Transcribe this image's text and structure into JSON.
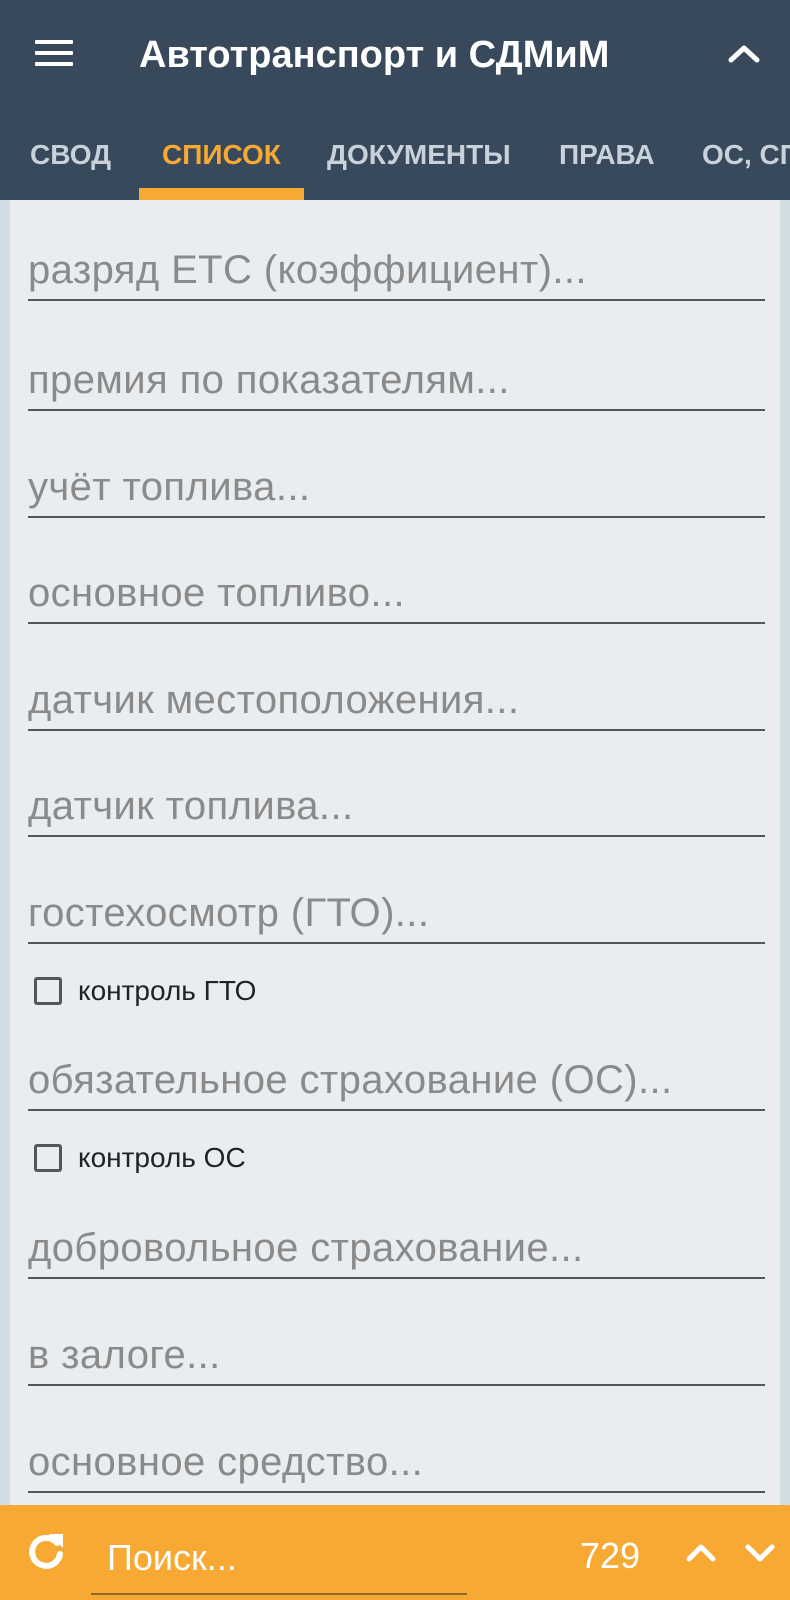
{
  "header": {
    "title": "Автотранспорт и СДМиМ",
    "icons": {
      "menu": "hamburger-menu-icon",
      "collapse": "chevron-up-icon"
    }
  },
  "tabs": [
    {
      "label": "СВОД",
      "active": false
    },
    {
      "label": "СПИСОК",
      "active": true
    },
    {
      "label": "ДОКУМЕНТЫ",
      "active": false
    },
    {
      "label": "ПРАВА",
      "active": false
    },
    {
      "label": "ОС, СП",
      "active": false
    }
  ],
  "form": {
    "fields": [
      "разряд ЕТС (коэффициент)...",
      "премия по показателям...",
      "учёт топлива...",
      "основное топливо...",
      "датчик местоположения...",
      "датчик топлива...",
      "гостехосмотр (ГТО)...",
      "обязательное страхование (ОС)...",
      "добровольное страхование...",
      "в залоге...",
      "основное средство..."
    ],
    "checkboxes": [
      {
        "label": "контроль ГТО",
        "checked": false
      },
      {
        "label": "контроль ОС",
        "checked": false
      }
    ]
  },
  "bottom_bar": {
    "search_placeholder": "Поиск...",
    "count": "729",
    "icons": {
      "refresh": "refresh-icon",
      "up": "chevron-up-icon",
      "down": "chevron-down-icon"
    }
  },
  "colors": {
    "header_bg": "#37495a",
    "accent": "#f7a934",
    "content_bg": "#e9edf0",
    "tab_inactive": "#c9d2da"
  }
}
